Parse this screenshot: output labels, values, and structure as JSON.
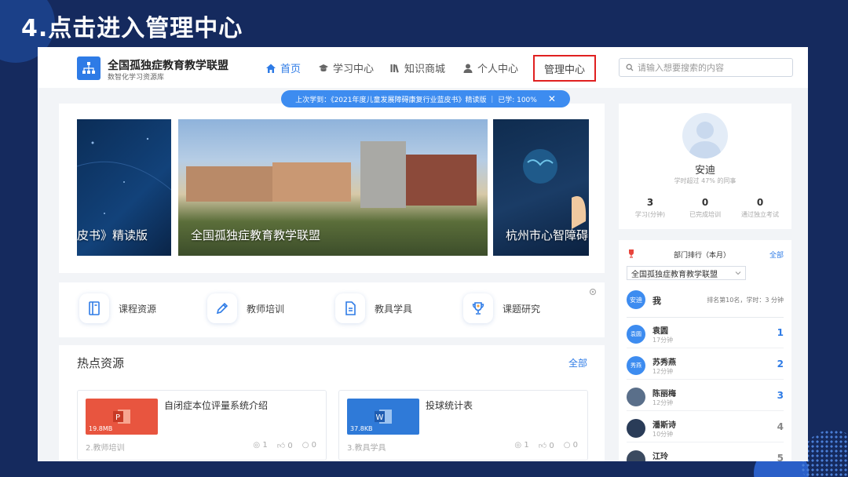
{
  "slide": {
    "title": "4.点击进入管理中心"
  },
  "header": {
    "logo_title": "全国孤独症教育教学联盟",
    "logo_subtitle": "数智化学习资源库",
    "nav": {
      "home": "首页",
      "learning": "学习中心",
      "store": "知识商城",
      "personal": "个人中心",
      "management": "管理中心"
    },
    "search_placeholder": "请输入想要搜索的内容"
  },
  "notice": {
    "text": "上次学到：《2021年度儿童发展障碍康复行业蓝皮书》精读版 ｜ 已学: 100%",
    "close": "✕"
  },
  "banners": {
    "left_caption": "皮书》精读版",
    "center_caption": "全国孤独症教育教学联盟",
    "right_caption": "杭州市心智障碍"
  },
  "categories": [
    {
      "label": "课程资源"
    },
    {
      "label": "教师培训"
    },
    {
      "label": "教具学具"
    },
    {
      "label": "课题研究"
    }
  ],
  "hot": {
    "title": "热点资源",
    "all": "全部",
    "items": [
      {
        "name": "自闭症本位评量系统介绍",
        "size": "19.8MB",
        "category": "2.教师培训",
        "views": "1",
        "likes": "0",
        "comments": "0",
        "color": "#e8553f"
      },
      {
        "name": "投球统计表",
        "size": "37.8KB",
        "category": "3.教具学具",
        "views": "1",
        "likes": "0",
        "comments": "0",
        "color": "#2f7ad8"
      }
    ]
  },
  "profile": {
    "name": "安迪",
    "subtitle": "学时超过 47% 的同事",
    "stats": [
      {
        "value": "3",
        "label": "学习(分钟)"
      },
      {
        "value": "0",
        "label": "已完成培训"
      },
      {
        "value": "0",
        "label": "通过独立考试"
      }
    ]
  },
  "rank": {
    "title": "部门排行（本月）",
    "all": "全部",
    "department": "全国孤独症教育教学联盟",
    "me": {
      "avatar": "安迪",
      "label": "我",
      "info": "排名第10名，学时：3 分钟"
    },
    "rows": [
      {
        "avatar": "袁圆",
        "name": "袁圆",
        "time": "17分钟",
        "rank": "1"
      },
      {
        "avatar": "秀燕",
        "name": "苏秀燕",
        "time": "12分钟",
        "rank": "2"
      },
      {
        "avatar": "",
        "name": "陈丽梅",
        "time": "12分钟",
        "rank": "3"
      },
      {
        "avatar": "",
        "name": "潘斯诗",
        "time": "10分钟",
        "rank": "4"
      },
      {
        "avatar": "",
        "name": "江玲",
        "time": "",
        "rank": "5"
      }
    ]
  }
}
